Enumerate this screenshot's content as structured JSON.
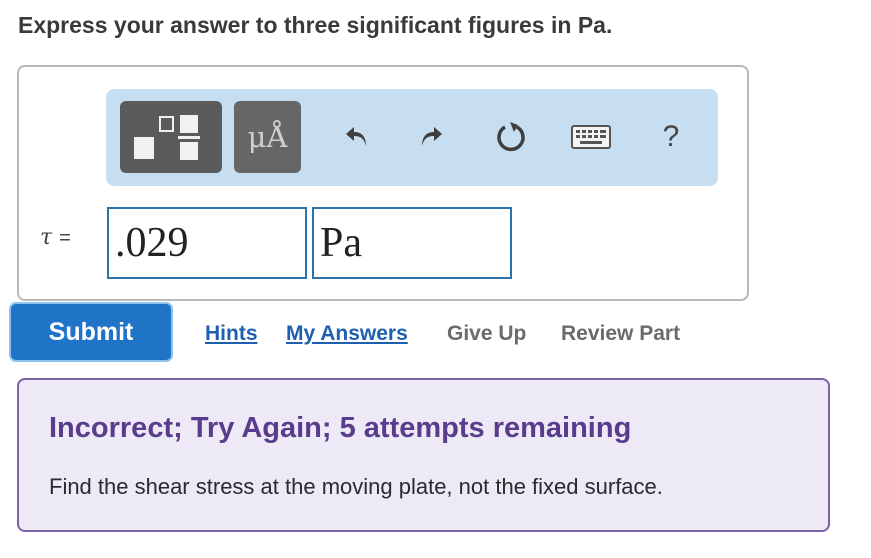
{
  "instruction": "Express your answer to three significant figures in Pa.",
  "toolbar": {
    "templates_icon": "templates-icon",
    "units_label": "μÅ",
    "undo_icon": "undo-icon",
    "redo_icon": "redo-icon",
    "reset_icon": "reset-icon",
    "keyboard_icon": "keyboard-icon",
    "help_label": "?"
  },
  "answer": {
    "variable": "τ",
    "equals": "=",
    "value": ".029",
    "unit": "Pa"
  },
  "actions": {
    "submit_label": "Submit",
    "hints_label": "Hints",
    "my_answers_label": "My Answers",
    "give_up_label": "Give Up",
    "review_part_label": "Review Part"
  },
  "feedback": {
    "title": "Incorrect; Try Again; 5 attempts remaining",
    "message": "Find the shear stress at the moving plate, not the fixed surface."
  },
  "colors": {
    "accent": "#1f74c8",
    "link": "#1f5fb0",
    "feedback_border": "#7b64a6",
    "feedback_bg": "#ede9f6",
    "feedback_title": "#5a3c8c",
    "toolbar_bg": "#c6def0"
  }
}
